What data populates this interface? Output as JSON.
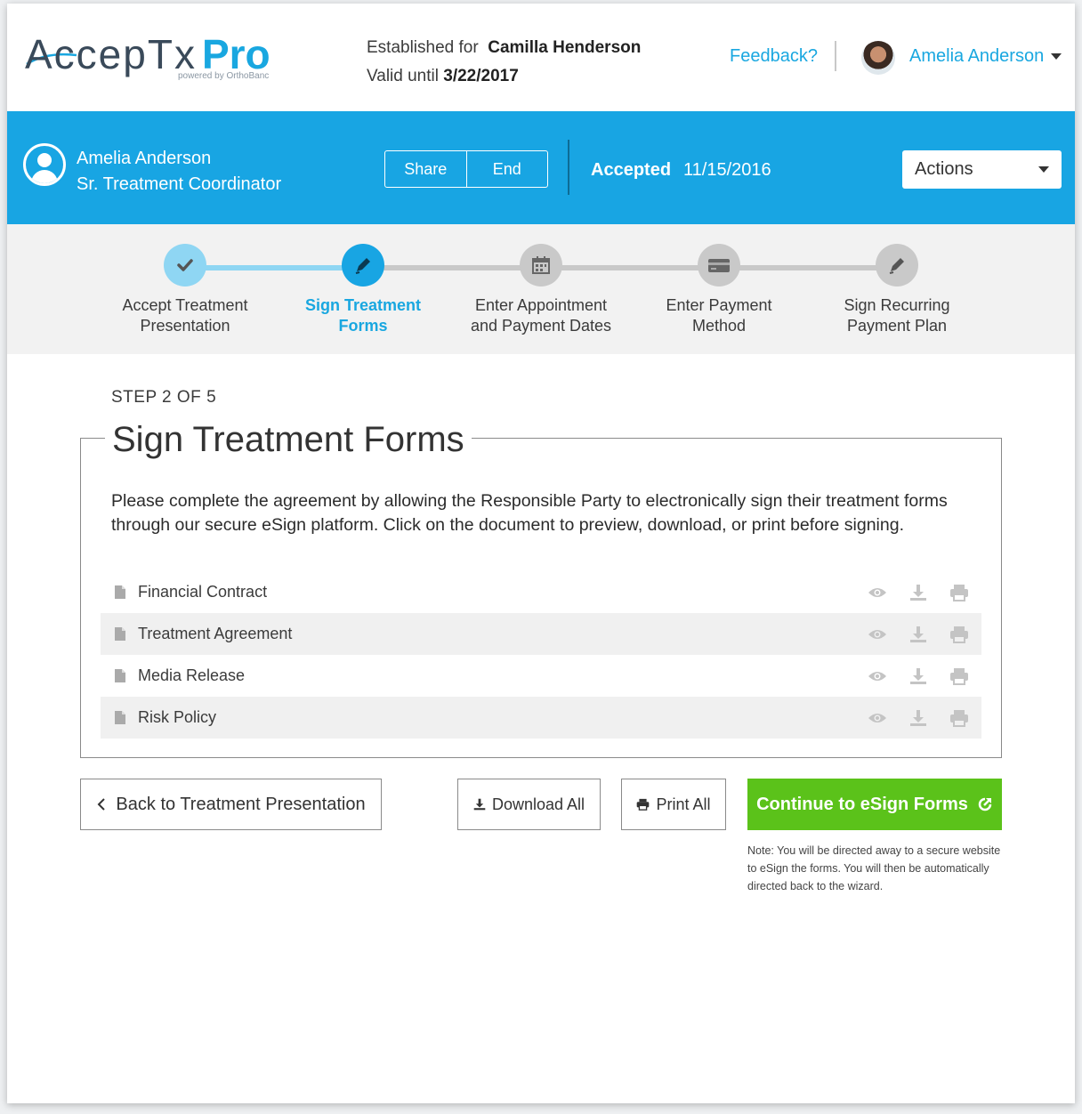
{
  "header": {
    "logo_text": "AccepTx",
    "logo_pro": "Pro",
    "logo_sub": "powered by OrthoBanc",
    "established_label": "Established for",
    "established_name": "Camilla Henderson",
    "valid_label": "Valid until",
    "valid_date": "3/22/2017",
    "feedback_link": "Feedback?",
    "user_name": "Amelia Anderson"
  },
  "bluebar": {
    "name": "Amelia Anderson",
    "role": "Sr. Treatment Coordinator",
    "share_label": "Share",
    "end_label": "End",
    "status_label": "Accepted",
    "status_date": "11/15/2016",
    "actions_label": "Actions"
  },
  "steps": [
    {
      "label_line1": "Accept Treatment",
      "label_line2": "Presentation",
      "state": "done",
      "icon": "check-icon"
    },
    {
      "label_line1": "Sign Treatment",
      "label_line2": "Forms",
      "state": "active",
      "icon": "pen-icon"
    },
    {
      "label_line1": "Enter Appointment",
      "label_line2": "and Payment Dates",
      "state": "pending",
      "icon": "calendar-icon"
    },
    {
      "label_line1": "Enter Payment",
      "label_line2": "Method",
      "state": "pending",
      "icon": "credit-card-icon"
    },
    {
      "label_line1": "Sign Recurring",
      "label_line2": "Payment Plan",
      "state": "pending",
      "icon": "pen-icon"
    }
  ],
  "content": {
    "step_count": "STEP 2 OF 5",
    "title": "Sign Treatment Forms",
    "description": "Please complete the agreement by allowing the Responsible Party to electronically sign their treatment forms through our secure eSign platform. Click on the document to preview, download, or print before signing.",
    "documents": [
      {
        "name": "Financial Contract"
      },
      {
        "name": "Treatment Agreement"
      },
      {
        "name": "Media Release"
      },
      {
        "name": "Risk Policy"
      }
    ]
  },
  "buttons": {
    "back_label": "Back to Treatment Presentation",
    "download_all_label": "Download All",
    "print_all_label": "Print All",
    "continue_label": "Continue to eSign Forms"
  },
  "note": "Note: You will be directed away to a secure website to eSign the forms. You will then be automatically directed back to the wizard.",
  "colors": {
    "brand_blue": "#18a5e3",
    "light_blue": "#8fd6f3",
    "success_green": "#5bc21a",
    "step_pending": "#c9c9c9"
  }
}
